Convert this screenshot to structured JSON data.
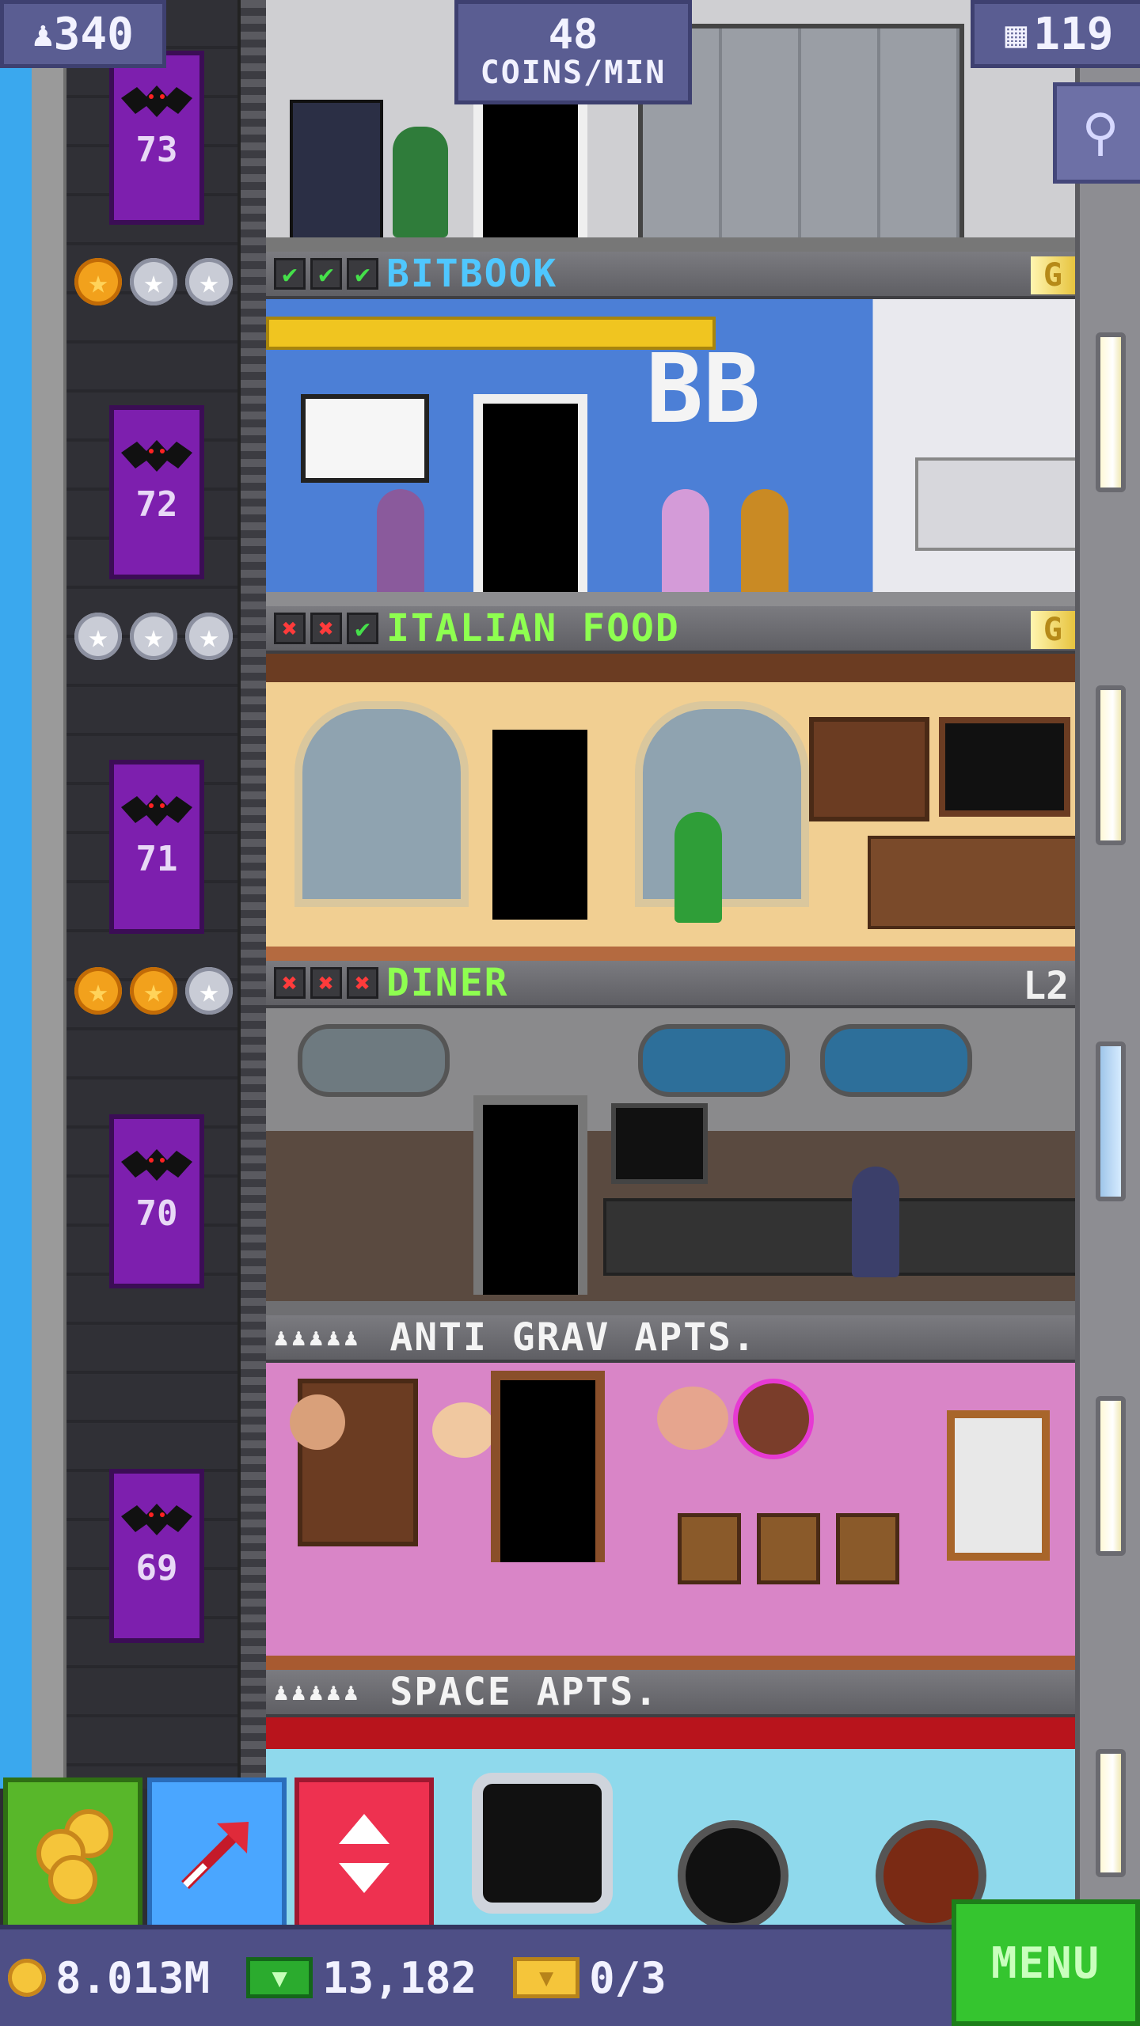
{
  "hud": {
    "population": "340",
    "coins_per_min_value": "48",
    "coins_per_min_unit": "COINS/MIN",
    "floor_count": "119"
  },
  "floors": [
    {
      "name": "BITBOOK",
      "checks": [
        "ok",
        "ok",
        "ok"
      ],
      "stars": [
        "gold",
        "silver",
        "silver"
      ],
      "badge": "G",
      "elevator": "72"
    },
    {
      "name": "ITALIAN FOOD",
      "checks": [
        "no",
        "no",
        "ok"
      ],
      "stars": [
        "silver",
        "silver",
        "silver"
      ],
      "badge": "G",
      "elevator": "71"
    },
    {
      "name": "DINER",
      "checks": [
        "no",
        "no",
        "no"
      ],
      "stars": [
        "gold",
        "gold",
        "silver"
      ],
      "badge": "L2",
      "elevator": "70"
    },
    {
      "name": "ANTI GRAV APTS.",
      "elevator": "69"
    },
    {
      "name": "SPACE APTS."
    }
  ],
  "elevator_top": "73",
  "icons": {
    "check_ok": "✔",
    "check_no": "✖",
    "star": "★",
    "resident": "♟"
  },
  "bottom_bar": {
    "coins": "8.013M",
    "bux": "13,182",
    "tickets": "0/3",
    "menu_label": "MENU"
  },
  "colors": {
    "hud_purple": "#5a5d92",
    "elevator_purple": "#7d1fae",
    "menu_green": "#35c52f",
    "name_blue": "#4fc7ff",
    "name_green": "#8eff50"
  }
}
